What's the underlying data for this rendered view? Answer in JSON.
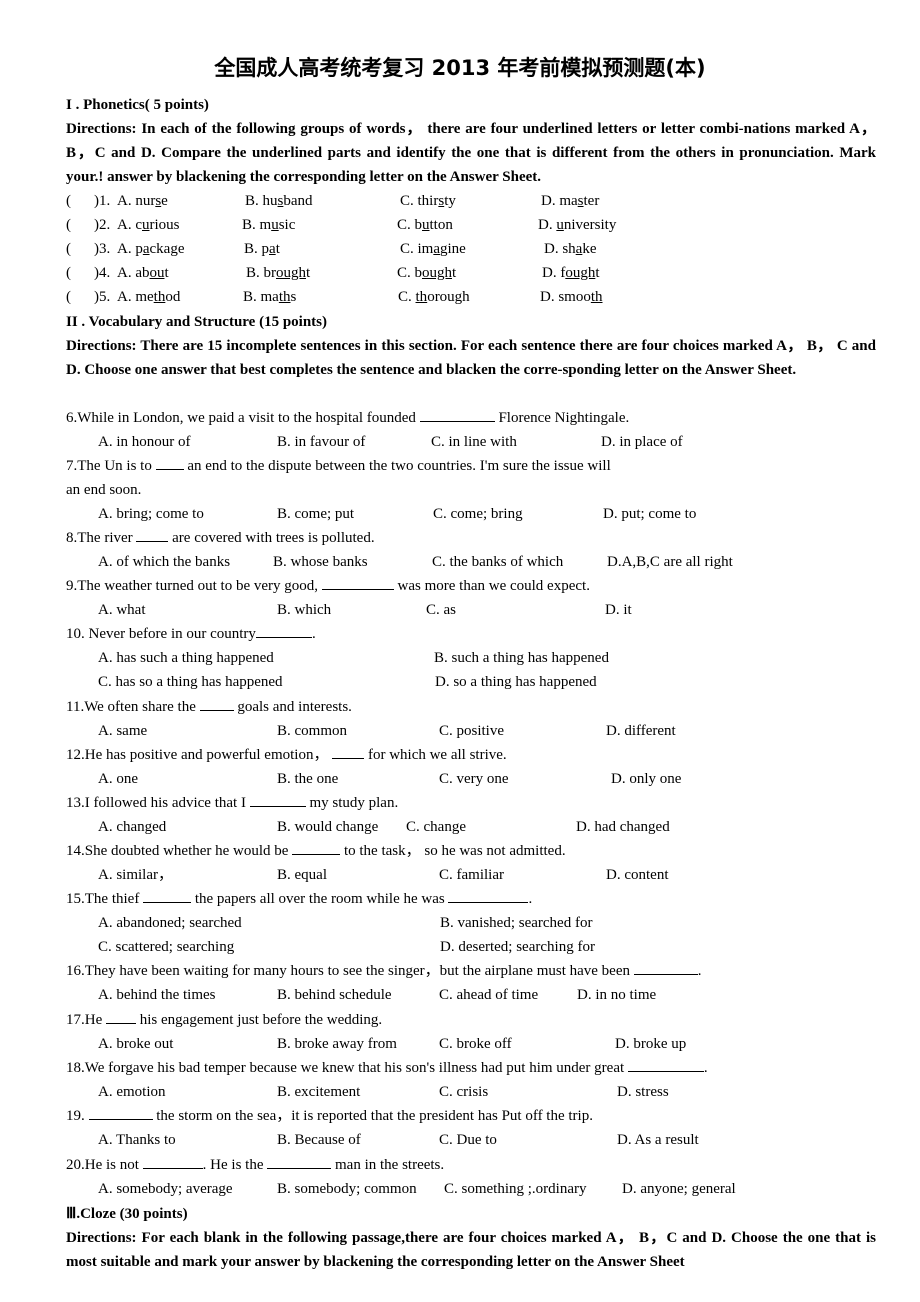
{
  "title": "全国成人高考统考复习 2013 年考前模拟预测题(本)",
  "section1": {
    "heading": "I . Phonetics( 5 points)",
    "directions": "Directions: In each of the following groups of words， there are four underlined letters or letter combi-nations marked A， B，C and D. Compare the underlined parts and identify the one that is different from the others in pronunciation. Mark your.! answer by blackening the corresponding letter on the Answer Sheet.",
    "questions": [
      {
        "num": ")1. ",
        "options": [
          {
            "label": "A. ",
            "pre": "nur",
            "u": "s",
            "post": "e"
          },
          {
            "label": "B. ",
            "pre": "hu",
            "u": "s",
            "post": "band"
          },
          {
            "label": "C. ",
            "pre": "thir",
            "u": "s",
            "post": "ty"
          },
          {
            "label": "D. ",
            "pre": "ma",
            "u": "s",
            "post": "ter"
          }
        ]
      },
      {
        "num": ")2. ",
        "options": [
          {
            "label": "A. ",
            "pre": "c",
            "u": "u",
            "post": "rious"
          },
          {
            "label": "B. ",
            "pre": "m",
            "u": "u",
            "post": "sic"
          },
          {
            "label": "C. ",
            "pre": "b",
            "u": "u",
            "post": "tton"
          },
          {
            "label": "D. ",
            "pre": "",
            "u": "u",
            "post": "niversity"
          }
        ]
      },
      {
        "num": ")3. ",
        "options": [
          {
            "label": "A. ",
            "pre": "p",
            "u": "a",
            "post": "ckage"
          },
          {
            "label": "B. ",
            "pre": "p",
            "u": "a",
            "post": "t"
          },
          {
            "label": "C. ",
            "pre": "im",
            "u": "a",
            "post": "gine"
          },
          {
            "label": "D. ",
            "pre": "sh",
            "u": "a",
            "post": "ke"
          }
        ]
      },
      {
        "num": ")4. ",
        "options": [
          {
            "label": "A. ",
            "pre": "ab",
            "u": "ou",
            "post": "t"
          },
          {
            "label": "B. ",
            "pre": "br",
            "u": "ough",
            "post": "t"
          },
          {
            "label": "C. ",
            "pre": "b",
            "u": "ough",
            "post": "t"
          },
          {
            "label": "D. ",
            "pre": "f",
            "u": "ough",
            "post": "t"
          }
        ]
      },
      {
        "num": ")5. ",
        "options": [
          {
            "label": "A. ",
            "pre": "me",
            "u": "th",
            "post": "od"
          },
          {
            "label": "B. ",
            "pre": "ma",
            "u": "th",
            "post": "s"
          },
          {
            "label": "C. ",
            "pre": "",
            "u": "th",
            "post": "orough"
          },
          {
            "label": "D. ",
            "pre": "smoo",
            "u": "th",
            "post": ""
          }
        ]
      }
    ]
  },
  "section2": {
    "heading": "II . Vocabulary and Structure (15 points)",
    "directions": "Directions: There are 15 incomplete sentences in this section. For each sentence there are four choices marked A， B， C and D. Choose one answer that best completes the sentence and blacken the corre-sponding letter on the Answer Sheet.",
    "q6": {
      "pre": "6.While in London, we paid a visit to the hospital founded ",
      "post": " Florence Nightingale.",
      "options": [
        "A. in honour of",
        "B. in favour of",
        "C. in line with",
        "D. in place of"
      ]
    },
    "q7": {
      "pre": "7.The Un is to ",
      "post": " an end to the dispute between the two countries. I'm sure the issue will",
      "line2": "an end soon.",
      "options": [
        "A. bring; come to",
        "B. come; put",
        "C. come; bring",
        "D. put; come to"
      ]
    },
    "q8": {
      "pre": "8.The river ",
      "post": " are covered with trees is polluted.",
      "options": [
        "A. of which the banks",
        "B. whose banks",
        "C. the banks of which",
        "D.A,B,C are all right"
      ]
    },
    "q9": {
      "pre": "9.The weather turned out to be very good, ",
      "post": " was more than we could expect.",
      "options": [
        "A. what",
        "B. which",
        "C. as",
        "D. it"
      ]
    },
    "q10": {
      "pre": "10. Never before in our country",
      "post": ".",
      "options": [
        "A. has such a thing happened",
        "B. such a thing has happened",
        "C. has so a thing has happened",
        "D. so a thing has happened"
      ]
    },
    "q11": {
      "pre": "11.We often share the ",
      "post": " goals and interests.",
      "options": [
        "A. same",
        "B. common",
        "C. positive",
        "D. different"
      ]
    },
    "q12": {
      "pre": "12.He has positive and powerful emotion， ",
      "post": " for which we all strive.",
      "options": [
        "A. one",
        "B. the one",
        "C. very one",
        "D. only one"
      ]
    },
    "q13": {
      "pre": "13.I followed his advice that I ",
      "post": " my study plan.",
      "options": [
        "A. changed",
        "B. would change",
        "C. change",
        "D. had changed"
      ]
    },
    "q14": {
      "pre": "14.She doubted whether he would be ",
      "post": " to the task， so he was not admitted.",
      "options": [
        "A. similar，",
        "B. equal",
        "C. familiar",
        "D. content"
      ]
    },
    "q15": {
      "pre": "15.The thief ",
      "mid": " the papers all over the room while he was ",
      "post": ".",
      "options": [
        "A. abandoned; searched",
        "B. vanished; searched for",
        "C. scattered; searching",
        "D. deserted; searching for"
      ]
    },
    "q16": {
      "pre": "16.They have been waiting for many hours to see the singer，but the airplane must have been ",
      "post": ".",
      "options": [
        "A. behind the times",
        "B. behind schedule",
        "C. ahead of time",
        "D. in no time"
      ]
    },
    "q17": {
      "pre": "17.He ",
      "post": " his engagement just before the wedding.",
      "options": [
        "A. broke out",
        "B. broke away from",
        "C. broke off",
        "D. broke up"
      ]
    },
    "q18": {
      "pre": "18.We forgave his bad temper because we knew that his son's illness had put him under great ",
      "post": ".",
      "options": [
        "A. emotion",
        "B. excitement",
        "C. crisis",
        "D. stress"
      ]
    },
    "q19": {
      "pre": "19. ",
      "post": " the storm on the sea，it is reported that the president has Put off the trip.",
      "options": [
        "A. Thanks to",
        "B. Because of",
        "C. Due to",
        "D. As a result"
      ]
    },
    "q20": {
      "pre": "20.He is not ",
      "mid": ". He is the ",
      "post": " man in the streets.",
      "options": [
        "A. somebody; average",
        "B. somebody; common",
        "C. something ;.ordinary",
        "D. anyone; general"
      ]
    }
  },
  "section3": {
    "heading": "Ⅲ.Cloze (30 points)",
    "directions": "Directions: For each blank in the following passage,there are four choices marked A， B，C and D. Choose the one that is most suitable and mark your answer by blackening the corresponding letter on the Answer Sheet"
  },
  "paren_open": "("
}
